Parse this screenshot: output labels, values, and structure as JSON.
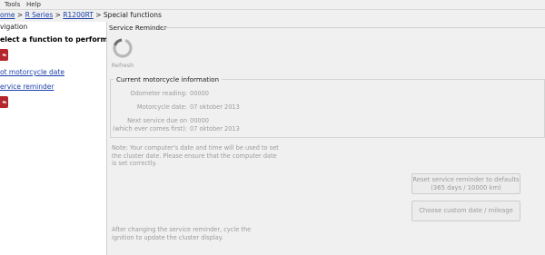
{
  "menu": {
    "tools": "Tools",
    "help": "Help"
  },
  "breadcrumb": {
    "home": "ome",
    "sep1": " > ",
    "r_series": "R Series",
    "sep2": " > ",
    "model": "R1200RT",
    "sep3": " > ",
    "current": "Special functions"
  },
  "navigation": {
    "title": "vigation",
    "prompt": "elect a function to perform.",
    "link_date": "ot motorcycle date",
    "link_reminder": "ervice reminder"
  },
  "service_reminder": {
    "group_title": "Service Reminder",
    "refresh_label": "Refresh",
    "info_title": "Current motorcycle information",
    "odometer_label": "Odometer reading:",
    "odometer_value": "00000",
    "date_label": "Motorcycle date:",
    "date_value": "07 oktober 2013",
    "next_label_1": "Next service due on",
    "next_label_2": "(which ever comes first):",
    "next_value_1": "00000",
    "next_value_2": "07 oktober 2013",
    "note": "Note: Your computer's date and time will be used to set the cluster date. Please ensure that the computer date is set correctly.",
    "reset_button_line1": "Reset service reminder to defaults",
    "reset_button_line2": "(365 days / 10000 km)",
    "custom_button": "Choose custom date / mileage",
    "after_note": "After changing the service reminder, cycle the ignition to update the cluster display."
  },
  "colors": {
    "nav_button": "#b4252c",
    "link": "#1a3faa",
    "disabled_text": "#9b9b9b"
  },
  "icons": {
    "nav_action": "back-arrow-icon",
    "refresh": "refresh-circle-icon"
  }
}
